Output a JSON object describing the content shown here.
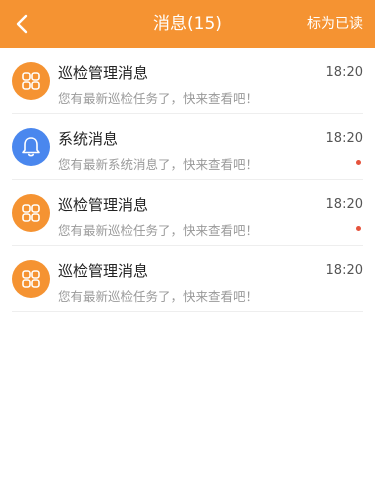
{
  "header": {
    "title": "消息(15)",
    "mark_all_read": "标为已读"
  },
  "colors": {
    "accent": "#F59332",
    "system": "#4A87EE",
    "unread_dot": "#E5533C"
  },
  "messages": [
    {
      "icon": "grid-icon",
      "title": "巡检管理消息",
      "subtitle": "您有最新巡检任务了，快来查看吧！",
      "time": "18:20",
      "unread": false
    },
    {
      "icon": "bell-icon",
      "title": "系统消息",
      "subtitle": "您有最新系统消息了，快来查看吧！",
      "time": "18:20",
      "unread": true
    },
    {
      "icon": "grid-icon",
      "title": "巡检管理消息",
      "subtitle": "您有最新巡检任务了，快来查看吧！",
      "time": "18:20",
      "unread": true
    },
    {
      "icon": "grid-icon",
      "title": "巡检管理消息",
      "subtitle": "您有最新巡检任务了，快来查看吧！",
      "time": "18:20",
      "unread": false
    }
  ]
}
